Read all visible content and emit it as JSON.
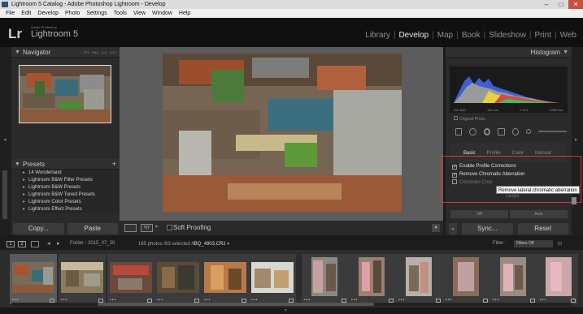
{
  "window": {
    "title": "Lightroom 5 Catalog - Adobe Photoshop Lightroom - Develop",
    "controls": [
      "–",
      "□",
      "✕"
    ]
  },
  "menu": [
    "File",
    "Edit",
    "Develop",
    "Photo",
    "Settings",
    "Tools",
    "View",
    "Window",
    "Help"
  ],
  "identity": {
    "logo": "Lr",
    "subtitle": "Adobe Photoshop",
    "product": "Lightroom 5"
  },
  "modules": [
    "Library",
    "Develop",
    "Map",
    "Book",
    "Slideshow",
    "Print",
    "Web"
  ],
  "active_module": "Develop",
  "navigator": {
    "title": "Navigator",
    "options": [
      "FIT",
      "FILL",
      "1:1",
      "1:2 ÷"
    ]
  },
  "presets": {
    "title": "Presets",
    "add": "+",
    "items": [
      "14 Wonderland",
      "Lightroom B&W Filter Presets",
      "Lightroom B&W Presets",
      "Lightroom B&W Toned Presets",
      "Lightroom Color Presets",
      "Lightroom Effect Presets"
    ]
  },
  "left_buttons": {
    "copy": "Copy...",
    "paste": "Paste"
  },
  "toolbar": {
    "soft_proofing": "Soft Proofing",
    "view_label": "Y|Y"
  },
  "histogram": {
    "title": "Histogram",
    "iso": "ISO 640",
    "focal": "115 mm",
    "aperture": "f / 6.3",
    "shutter": "1/200 sec",
    "original_photo": "Original Photo"
  },
  "lens_tabs": [
    "Basic",
    "Profile",
    "Color",
    "Manual"
  ],
  "active_lens_tab": "Basic",
  "lens_options": [
    {
      "label": "Enable Profile Corrections",
      "checked": true
    },
    {
      "label": "Remove Chromatic Aberration",
      "checked": true
    },
    {
      "label": "Constrain Crop",
      "checked": false
    }
  ],
  "upright": "Upright",
  "tooltip": "Remove lateral chromatic aberration",
  "upright_buttons": [
    "Off",
    "Auto"
  ],
  "right_buttons": {
    "sync": "Sync...",
    "reset": "Reset"
  },
  "filmstrip_bar": {
    "page1": "1",
    "page2": "2",
    "folder": "Folder : 2015_07_20",
    "photos_count": "165 photos /63 selected /",
    "current_file": "IBQ_4903.CR2",
    "filter_label": "Filter :",
    "filter_value": "Filters Off"
  },
  "thumb_dots": "•••",
  "colors": {
    "accent_highlight": "#d33333",
    "panel": "#2a2a2a",
    "background": "#1b1b1b"
  }
}
